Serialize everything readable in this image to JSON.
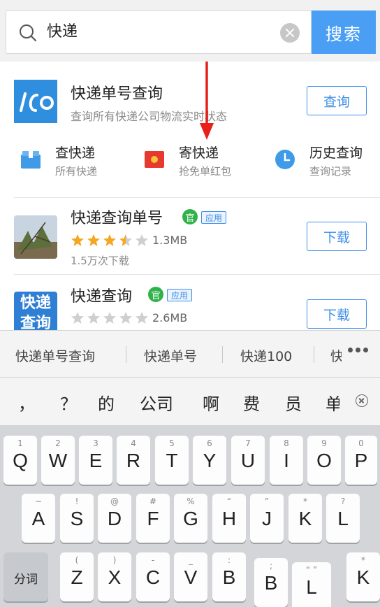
{
  "search": {
    "query": "快递",
    "button_label": "搜索"
  },
  "card_main": {
    "logo_text": "100",
    "title": "快递单号查询",
    "subtitle": "查询所有快递公司物流实时状态",
    "action_label": "查询"
  },
  "quick_links": [
    {
      "title": "查快递",
      "subtitle": "所有快递",
      "icon": "box-icon"
    },
    {
      "title": "寄快递",
      "subtitle": "抢免单红包",
      "icon": "red-packet-icon"
    },
    {
      "title": "历史查询",
      "subtitle": "查询记录",
      "icon": "clock-icon"
    }
  ],
  "apps": [
    {
      "title": "快递查询单号",
      "official_badge": "官",
      "type_badge": "应用",
      "rating": 3.5,
      "size": "1.3MB",
      "downloads": "1.5万次下载",
      "action_label": "下载"
    },
    {
      "title": "快递查询",
      "icon_text": "快递查询",
      "official_badge": "官",
      "type_badge": "应用",
      "rating": 0,
      "size": "2.6MB",
      "action_label": "下载"
    }
  ],
  "suggestions": [
    "快递单号查询",
    "快递单号",
    "快递100",
    "快"
  ],
  "candidates": [
    "，",
    "？",
    "的",
    "公司",
    "啊",
    "费",
    "员",
    "单"
  ],
  "keyboard": {
    "row1": [
      {
        "hint": "1",
        "letter": "Q"
      },
      {
        "hint": "2",
        "letter": "W"
      },
      {
        "hint": "3",
        "letter": "E"
      },
      {
        "hint": "4",
        "letter": "R"
      },
      {
        "hint": "5",
        "letter": "T"
      },
      {
        "hint": "6",
        "letter": "Y"
      },
      {
        "hint": "7",
        "letter": "U"
      },
      {
        "hint": "8",
        "letter": "I"
      },
      {
        "hint": "9",
        "letter": "O"
      },
      {
        "hint": "0",
        "letter": "P"
      }
    ],
    "row2": [
      {
        "hint": "~",
        "letter": "A"
      },
      {
        "hint": "!",
        "letter": "S"
      },
      {
        "hint": "@",
        "letter": "D"
      },
      {
        "hint": "#",
        "letter": "F"
      },
      {
        "hint": "%",
        "letter": "G"
      },
      {
        "hint": "“",
        "letter": "H"
      },
      {
        "hint": "”",
        "letter": "J"
      },
      {
        "hint": "*",
        "letter": "K"
      },
      {
        "hint": "?",
        "letter": "L"
      }
    ],
    "row3_special": "分词",
    "row3": [
      {
        "hint": "(",
        "letter": "Z"
      },
      {
        "hint": ")",
        "letter": "X"
      },
      {
        "hint": "-",
        "letter": "C"
      },
      {
        "hint": "_",
        "letter": "V"
      },
      {
        "hint": ":",
        "letter": "B"
      },
      {
        "hint": ";",
        "letter": "B"
      },
      {
        "hint": "“ ”",
        "letter": "L"
      },
      {
        "hint": "*",
        "letter": "K"
      }
    ]
  },
  "colors": {
    "accent": "#4a9ff5",
    "official_green": "#2fb24a",
    "star_gold": "#f5a623",
    "annotation_red": "#e8201a"
  }
}
